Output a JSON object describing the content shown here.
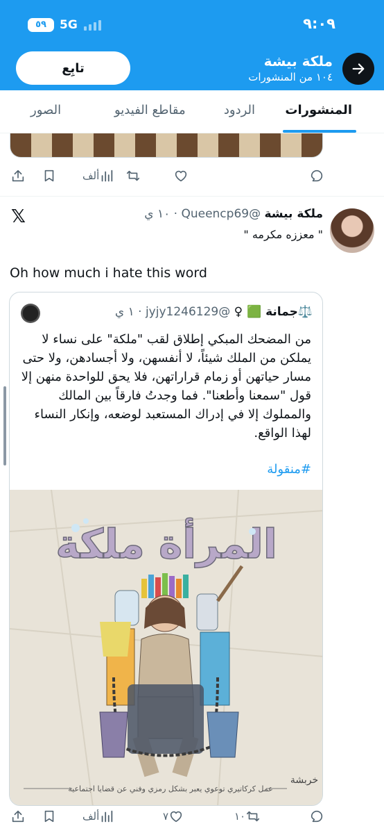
{
  "status_bar": {
    "time": "٩:٠٩",
    "network": "5G",
    "battery": "٥٩"
  },
  "header": {
    "profile_name": "ملكة بيشة",
    "post_count": "١٠٤ من المنشورات",
    "follow_label": "تابِع"
  },
  "tabs": [
    {
      "label": "المنشورات",
      "active": true
    },
    {
      "label": "الردود",
      "active": false
    },
    {
      "label": "مقاطع الفيديو",
      "active": false
    },
    {
      "label": "الصور",
      "active": false
    }
  ],
  "prev_actions": {
    "views": "ألف"
  },
  "tweet": {
    "author": "ملكة بيشة",
    "handle": "@Queencp69",
    "time": "١٠ ي",
    "bio_line": "\" معززه مكرمه \"",
    "text": "Oh how much i hate this word",
    "quote": {
      "author_display": "⚖️جمانة 🟩 ♀",
      "handle": "@jyjy1246129",
      "time": "١ ي",
      "body": "من المضحك المبكي إطلاق لقب \"ملكة\" على نساء لا يملكن من الملك شيئاً، لا أنفسهن، ولا أجسادهن، ولا حتى مسار حياتهن أو زمام قراراتهن، فلا يحق للواحدة منهن إلا قول \"سمعنا وأطعنا\". فما وجدتُ فارقاً بين المالك والمملوك إلا في إدراك المستعبد لوضعه، وإنكار النساء لهذا الواقع.",
      "hashtag": "#منقولة",
      "image_title": "المرأة ملكة",
      "image_caption": "عمل كركاتيري توعوي يعبر بشكل رمزي وفني عن قضايا اجتماعية",
      "image_signature": "خربشة"
    },
    "actions": {
      "retweets": "١٠",
      "likes": "٧",
      "views": "ألف"
    }
  },
  "colors": {
    "accent": "#1d9bf0",
    "text": "#0f1419",
    "muted": "#536471"
  },
  "icons": [
    "arrow-right-icon",
    "x-logo-icon",
    "reply-icon",
    "retweet-icon",
    "like-icon",
    "views-icon",
    "bookmark-icon",
    "share-icon"
  ]
}
